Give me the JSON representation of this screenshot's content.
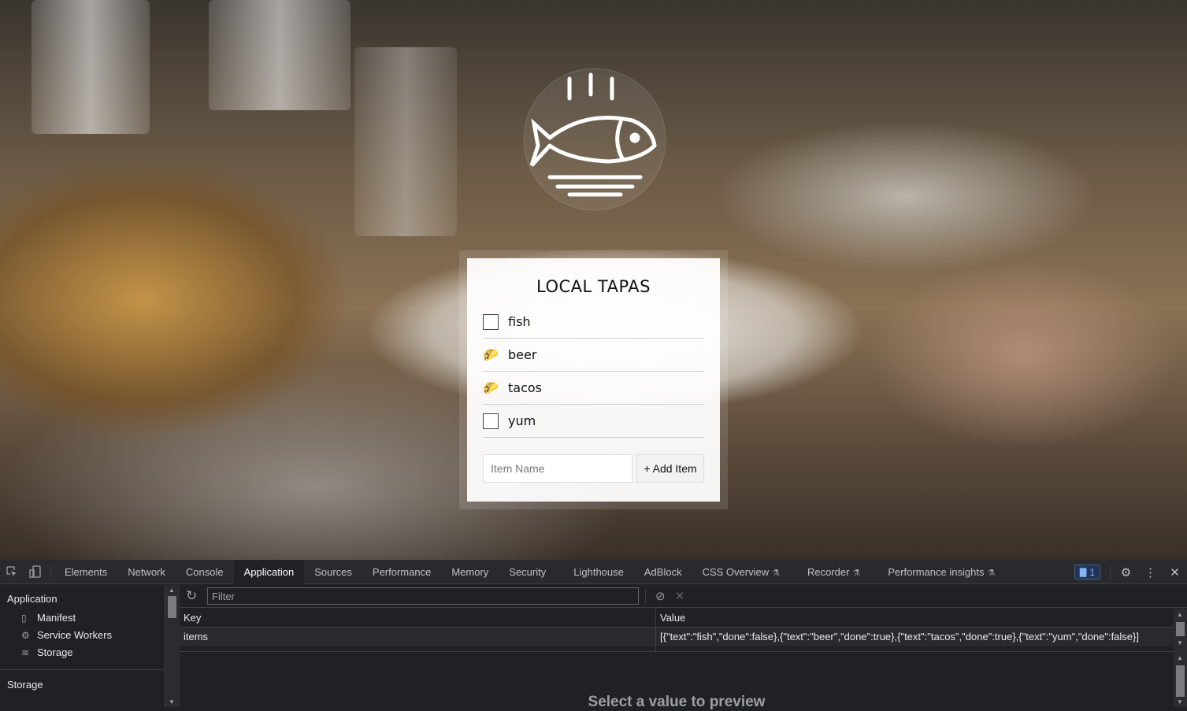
{
  "app": {
    "title": "LOCAL TAPAS",
    "items": [
      {
        "text": "fish",
        "done": false,
        "mark": "☐"
      },
      {
        "text": "beer",
        "done": true,
        "mark": "🌮"
      },
      {
        "text": "tacos",
        "done": true,
        "mark": "🌮"
      },
      {
        "text": "yum",
        "done": false,
        "mark": "☐"
      }
    ],
    "input_placeholder": "Item Name",
    "add_button": "+ Add Item"
  },
  "devtools": {
    "tabs": [
      {
        "label": "Elements"
      },
      {
        "label": "Network"
      },
      {
        "label": "Console"
      },
      {
        "label": "Application",
        "active": true
      },
      {
        "label": "Sources"
      },
      {
        "label": "Performance"
      },
      {
        "label": "Memory"
      },
      {
        "label": "Security"
      },
      {
        "label": "Lighthouse"
      },
      {
        "label": "AdBlock"
      },
      {
        "label": "CSS Overview",
        "experimental": true
      },
      {
        "label": "Recorder",
        "experimental": true
      },
      {
        "label": "Performance insights",
        "experimental": true
      }
    ],
    "issues_count": "1",
    "sidebar": {
      "heading": "Application",
      "items": [
        {
          "label": "Manifest",
          "icon": "file-icon"
        },
        {
          "label": "Service Workers",
          "icon": "gear-icon"
        },
        {
          "label": "Storage",
          "icon": "database-icon"
        }
      ],
      "storage_heading": "Storage"
    },
    "filter_placeholder": "Filter",
    "table": {
      "headers": {
        "key": "Key",
        "value": "Value"
      },
      "rows": [
        {
          "key": "items",
          "value": "[{\"text\":\"fish\",\"done\":false},{\"text\":\"beer\",\"done\":true},{\"text\":\"tacos\",\"done\":true},{\"text\":\"yum\",\"done\":false}]"
        }
      ]
    },
    "preview_text": "Select a value to preview"
  }
}
